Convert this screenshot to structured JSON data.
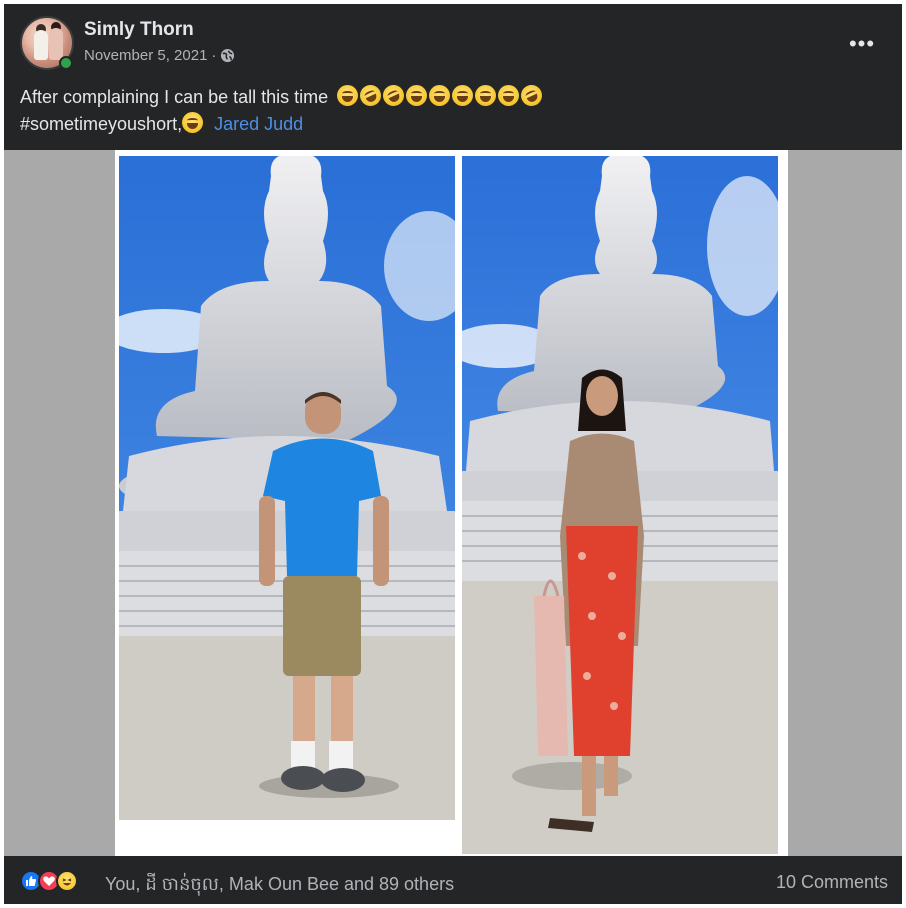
{
  "post": {
    "author": "Simly Thorn",
    "date": "November 5, 2021",
    "separator": "·",
    "privacy_icon": "globe-icon",
    "more_icon": "more-horizontal-icon",
    "more_label": "•••",
    "caption_line1": "After complaining I can be tall this time",
    "caption_hashtag": "#sometimeyoushort,",
    "tagged_person": "Jared Judd",
    "emoji_count": 9
  },
  "photos": [
    {
      "subject": "man in blue polo and khaki shorts in front of large white Buddha statue"
    },
    {
      "subject": "woman in beige cardigan and red floral skirt in front of large white Buddha statue"
    }
  ],
  "footer": {
    "reaction_icons": [
      "like-icon",
      "love-icon",
      "haha-icon"
    ],
    "reactions_text": "You, ដី ចាន់ចុល, Mak Oun Bee and 89 others",
    "comments_text": "10 Comments"
  },
  "colors": {
    "card_bg": "#242526",
    "link": "#4d8fe8",
    "secondary_text": "#b0b3b8",
    "primary_text": "#e4e6eb",
    "sky": "#2f7fe0"
  }
}
